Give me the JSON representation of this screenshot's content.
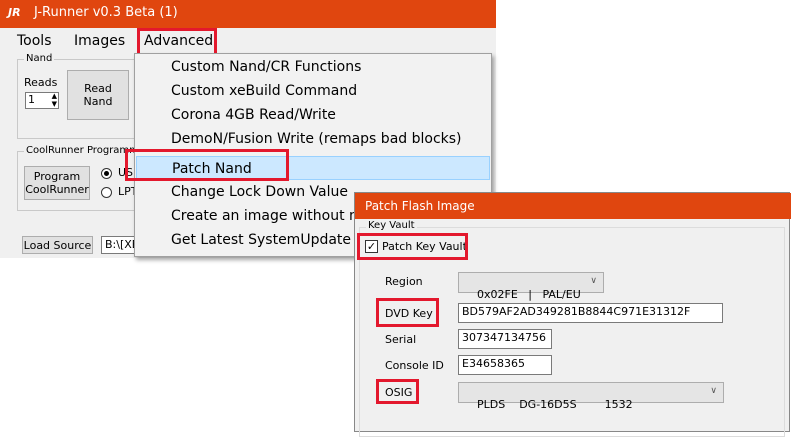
{
  "window": {
    "logo": "JR",
    "title": "J-Runner v0.3 Beta (1)"
  },
  "menubar": {
    "items": [
      "Tools",
      "Images",
      "Advanced"
    ]
  },
  "nand_group": {
    "label": "Nand",
    "reads_label": "Reads",
    "reads_value": "1",
    "read_button": "Read\nNand"
  },
  "coolrunner_group": {
    "label": "CoolRunner Programmer",
    "program_button": "Program\nCoolRunner",
    "radio_usb": "US",
    "radio_lpt": "LPT"
  },
  "bottom": {
    "load_source": "Load Source",
    "source_path": "B:\\[XE"
  },
  "advanced_menu": {
    "items": [
      "Custom Nand/CR Functions",
      "Custom xeBuild Command",
      "Corona 4GB Read/Write",
      "DemoN/Fusion Write (remaps bad blocks)",
      "Patch Nand",
      "Change Lock Down Value",
      "Create an image without nand",
      "Get Latest SystemUpdate"
    ]
  },
  "dialog": {
    "title": "Patch Flash Image",
    "group_label": "Key Vault",
    "patch_kv_label": "Patch Key Vault",
    "patch_kv_checked": true,
    "region_label": "Region",
    "region_value": "0x02FE   |   PAL/EU",
    "dvd_key_label": "DVD Key",
    "dvd_key_value": "BD579AF2AD349281B8844C971E31312F",
    "serial_label": "Serial",
    "serial_value": "307347134756",
    "console_id_label": "Console ID",
    "console_id_value": "E34658365",
    "osig_label": "OSIG",
    "osig_value": "PLDS    DG-16D5S        1532"
  },
  "colors": {
    "titlebar": "#e0460f",
    "highlight": "#e3182d",
    "selection": "#cce8ff"
  }
}
